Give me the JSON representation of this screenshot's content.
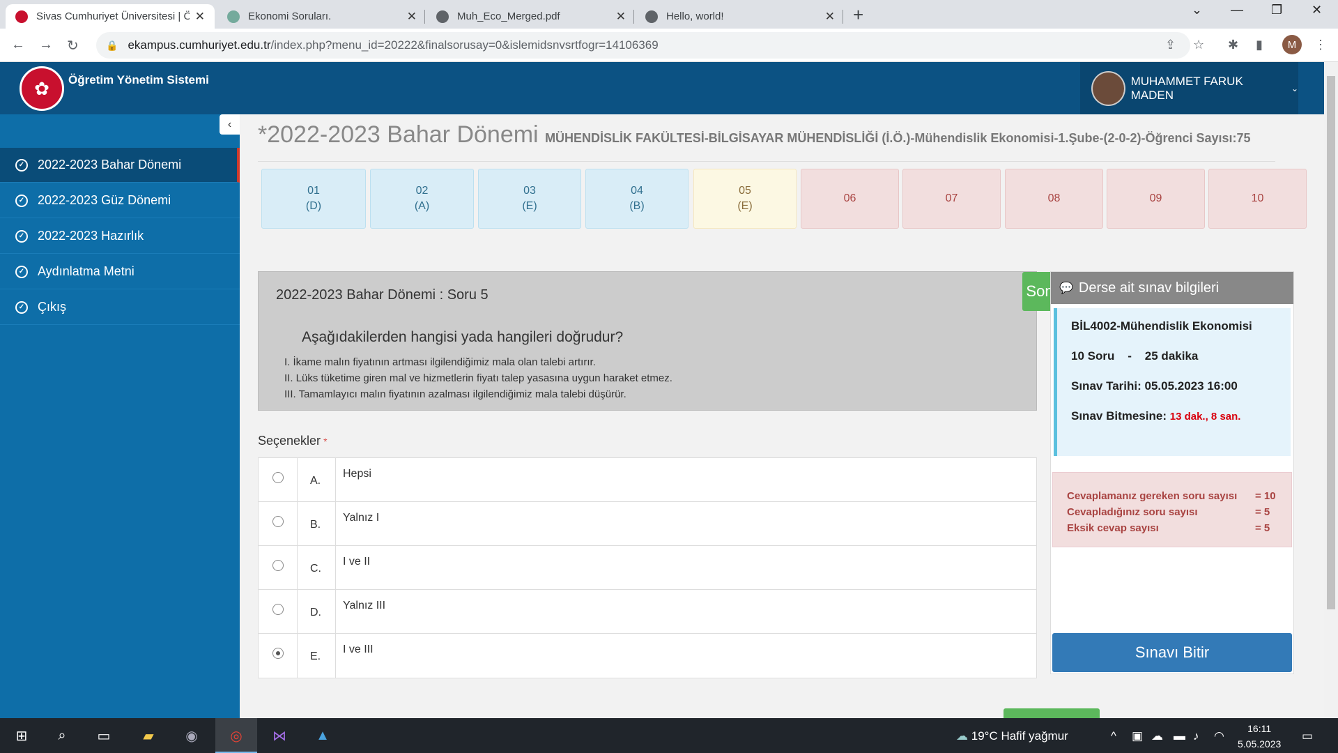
{
  "browser": {
    "tabs": [
      {
        "title": "Sivas Cumhuriyet Üniversitesi | Ö",
        "active": true
      },
      {
        "title": "Ekonomi Soruları."
      },
      {
        "title": "Muh_Eco_Merged.pdf"
      },
      {
        "title": "Hello, world!"
      }
    ],
    "url_host": "ekampus.cumhuriyet.edu.tr",
    "url_path": "/index.php?menu_id=20222&finalsorusay=0&islemidsnvsrtfogr=14106369",
    "profile_initial": "M"
  },
  "header": {
    "brand": "Öğretim Yönetim Sistemi",
    "user_name": "MUHAMMET FARUK MADEN"
  },
  "sidebar": {
    "items": [
      {
        "label": "2022-2023 Bahar Dönemi",
        "active": true
      },
      {
        "label": "2022-2023 Güz Dönemi"
      },
      {
        "label": "2022-2023 Hazırlık"
      },
      {
        "label": "Aydınlatma Metni"
      },
      {
        "label": "Çıkış"
      }
    ]
  },
  "page": {
    "title": "*2022-2023 Bahar Dönemi",
    "subtitle": "MÜHENDİSLİK FAKÜLTESİ-BİLGİSAYAR MÜHENDİSLİĞİ (İ.Ö.)-Mühendislik Ekonomisi-1.Şube-(2-0-2)-Öğrenci Sayısı:75"
  },
  "questions": [
    {
      "num": "01",
      "answer": "(D)",
      "state": "done"
    },
    {
      "num": "02",
      "answer": "(A)",
      "state": "done"
    },
    {
      "num": "03",
      "answer": "(E)",
      "state": "done"
    },
    {
      "num": "04",
      "answer": "(B)",
      "state": "done"
    },
    {
      "num": "05",
      "answer": "(E)",
      "state": "current"
    },
    {
      "num": "06",
      "answer": "",
      "state": "todo"
    },
    {
      "num": "07",
      "answer": "",
      "state": "todo"
    },
    {
      "num": "08",
      "answer": "",
      "state": "todo"
    },
    {
      "num": "09",
      "answer": "",
      "state": "todo"
    },
    {
      "num": "10",
      "answer": "",
      "state": "todo"
    }
  ],
  "question": {
    "heading": "2022-2023 Bahar Dönemi : Soru 5",
    "next_label": "Sonraki Soru",
    "text": "Aşağıdakilerden hangisi yada hangileri doğrudur?",
    "lines": [
      "I. İkame malın fiyatının artması ilgilendiğimiz mala olan talebi artırır.",
      "II. Lüks tüketime giren  mal ve hizmetlerin fiyatı talep yasasına uygun haraket etmez.",
      "III. Tamamlayıcı malın fiyatının azalması ilgilendiğimiz mala talebi düşürür."
    ],
    "options_label": "Seçenekler",
    "required_mark": "*",
    "options": [
      {
        "letter": "A.",
        "text": "Hepsi",
        "selected": false
      },
      {
        "letter": "B.",
        "text": "Yalnız I",
        "selected": false
      },
      {
        "letter": "C.",
        "text": "I ve II",
        "selected": false
      },
      {
        "letter": "D.",
        "text": "Yalnız III",
        "selected": false
      },
      {
        "letter": "E.",
        "text": "I ve III",
        "selected": true
      }
    ]
  },
  "exam_info": {
    "heading": "Derse ait sınav bilgileri",
    "course": "BİL4002-Mühendislik Ekonomisi",
    "summary": "10 Soru    -    25 dakika",
    "date": "Sınav Tarihi: 05.05.2023 16:00",
    "remaining_label": "Sınav Bitmesine:",
    "remaining_value": "13 dak., 8 san.",
    "stats": [
      {
        "label": "Cevaplamanız gereken soru sayısı",
        "value": "= 10"
      },
      {
        "label": "Cevapladığınız soru sayısı",
        "value": "= 5"
      },
      {
        "label": "Eksik cevap sayısı",
        "value": "= 5"
      }
    ],
    "finish_label": "Sınavı Bitir"
  },
  "taskbar": {
    "weather": "19°C  Hafif yağmur",
    "time": "16:11",
    "date": "5.05.2023"
  }
}
